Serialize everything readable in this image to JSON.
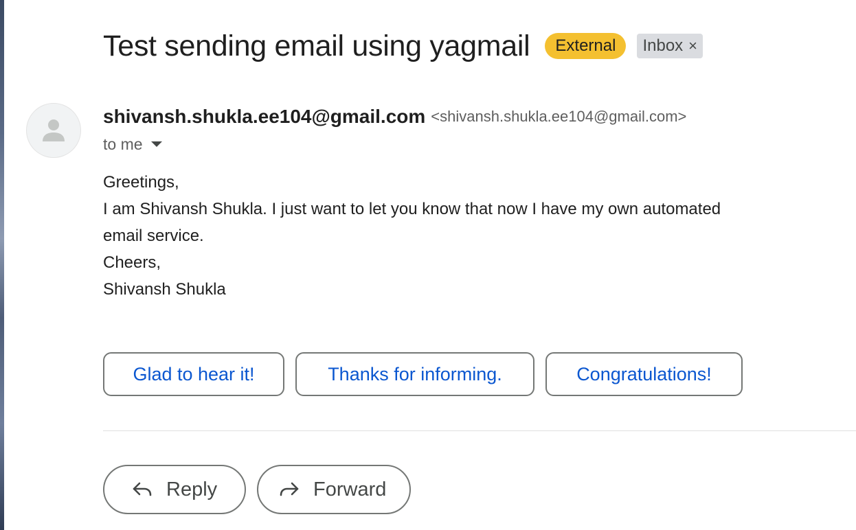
{
  "email": {
    "subject": "Test sending email using yagmail",
    "labels": {
      "external": "External",
      "inbox": "Inbox",
      "inbox_remove": "×"
    },
    "sender": {
      "name": "shivansh.shukla.ee104@gmail.com",
      "email": "<shivansh.shukla.ee104@gmail.com>",
      "avatar_icon": "person-icon"
    },
    "recipient": "to me",
    "body_lines": [
      "Greetings,",
      "I am Shivansh Shukla. I just want to let you know that now I have my own automated",
      "email service.",
      "Cheers,",
      "Shivansh Shukla"
    ]
  },
  "smart_replies": [
    "Glad to hear it!",
    "Thanks for informing.",
    "Congratulations!"
  ],
  "actions": {
    "reply_label": "Reply",
    "forward_label": "Forward",
    "reply_icon": "reply-icon",
    "forward_icon": "forward-icon"
  },
  "colors": {
    "external_badge": "#f4c030",
    "inbox_badge": "#dadce0",
    "chip_text": "#0b57d0"
  }
}
